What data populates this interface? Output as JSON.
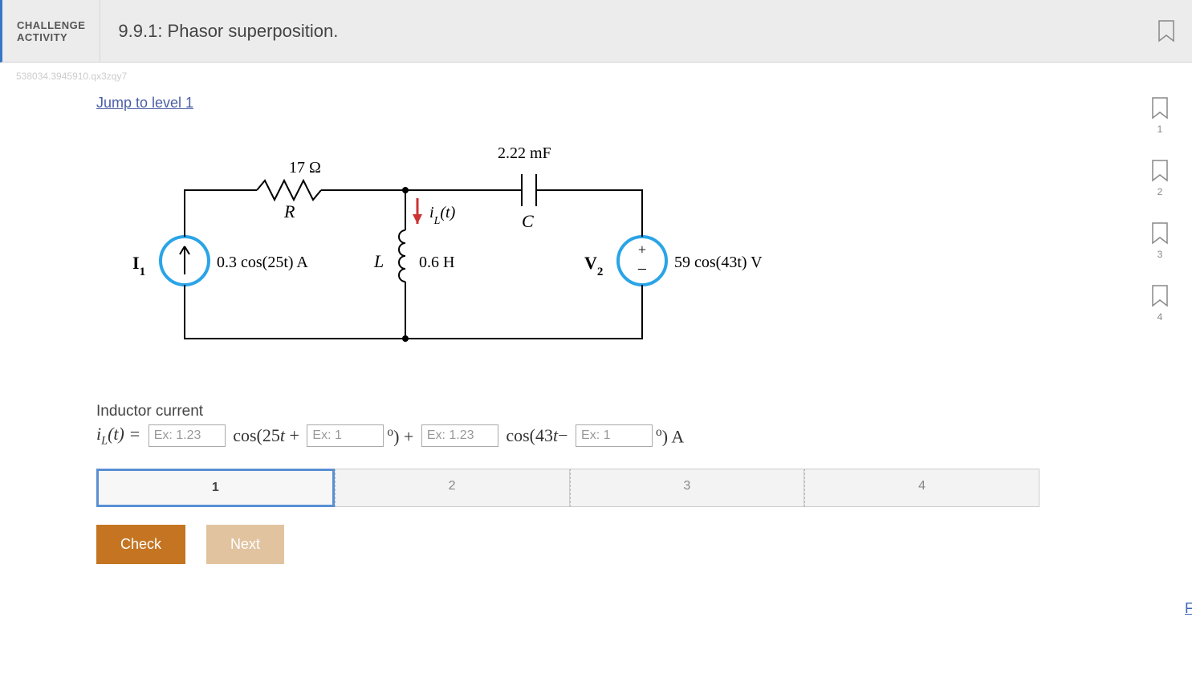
{
  "header": {
    "badge_line1": "CHALLENGE",
    "badge_line2": "ACTIVITY",
    "title": "9.9.1: Phasor superposition."
  },
  "tracking_id": "538034.3945910.qx3zqy7",
  "jump_link": "Jump to level 1",
  "circuit": {
    "resistor_value": "17 Ω",
    "resistor_label": "R",
    "inductor_current_symbol": "i_L(t)",
    "capacitor_value": "2.22 mF",
    "capacitor_label": "C",
    "source1_label": "I₁",
    "source1_value": "0.3 cos(25t) A",
    "inductor_label": "L",
    "inductor_value": "0.6 H",
    "source2_label": "V₂",
    "source2_value": "59 cos(43t) V"
  },
  "question": {
    "label": "Inductor current",
    "lhs_symbol": "i_L(t) = ",
    "placeholder_amp": "Ex: 1.23",
    "placeholder_deg": "Ex: 1",
    "cos1_prefix": "cos(25t + ",
    "mid": ") + ",
    "cos2_prefix": "cos(43t− ",
    "tail": ") A"
  },
  "progress": {
    "steps": [
      "1",
      "2",
      "3",
      "4"
    ],
    "active_index": 0
  },
  "buttons": {
    "check": "Check",
    "next": "Next"
  },
  "feedback_link": "Feedback?",
  "side_bookmarks": [
    "1",
    "2",
    "3",
    "4"
  ]
}
